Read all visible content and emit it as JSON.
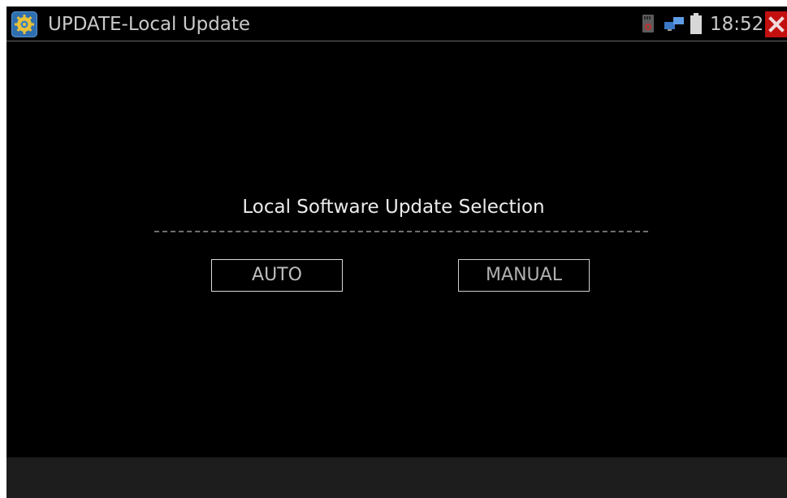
{
  "titlebar": {
    "app_icon": "gear-icon",
    "title": "UPDATE-Local Update",
    "status_icons": [
      "sd-card-icon",
      "network-icon",
      "battery-icon"
    ],
    "time": "18:52",
    "close_icon": "close-icon",
    "close_color": "#c40f0f"
  },
  "main": {
    "heading": "Local Software Update Selection",
    "buttons": {
      "auto": "AUTO",
      "manual": "MANUAL"
    }
  }
}
